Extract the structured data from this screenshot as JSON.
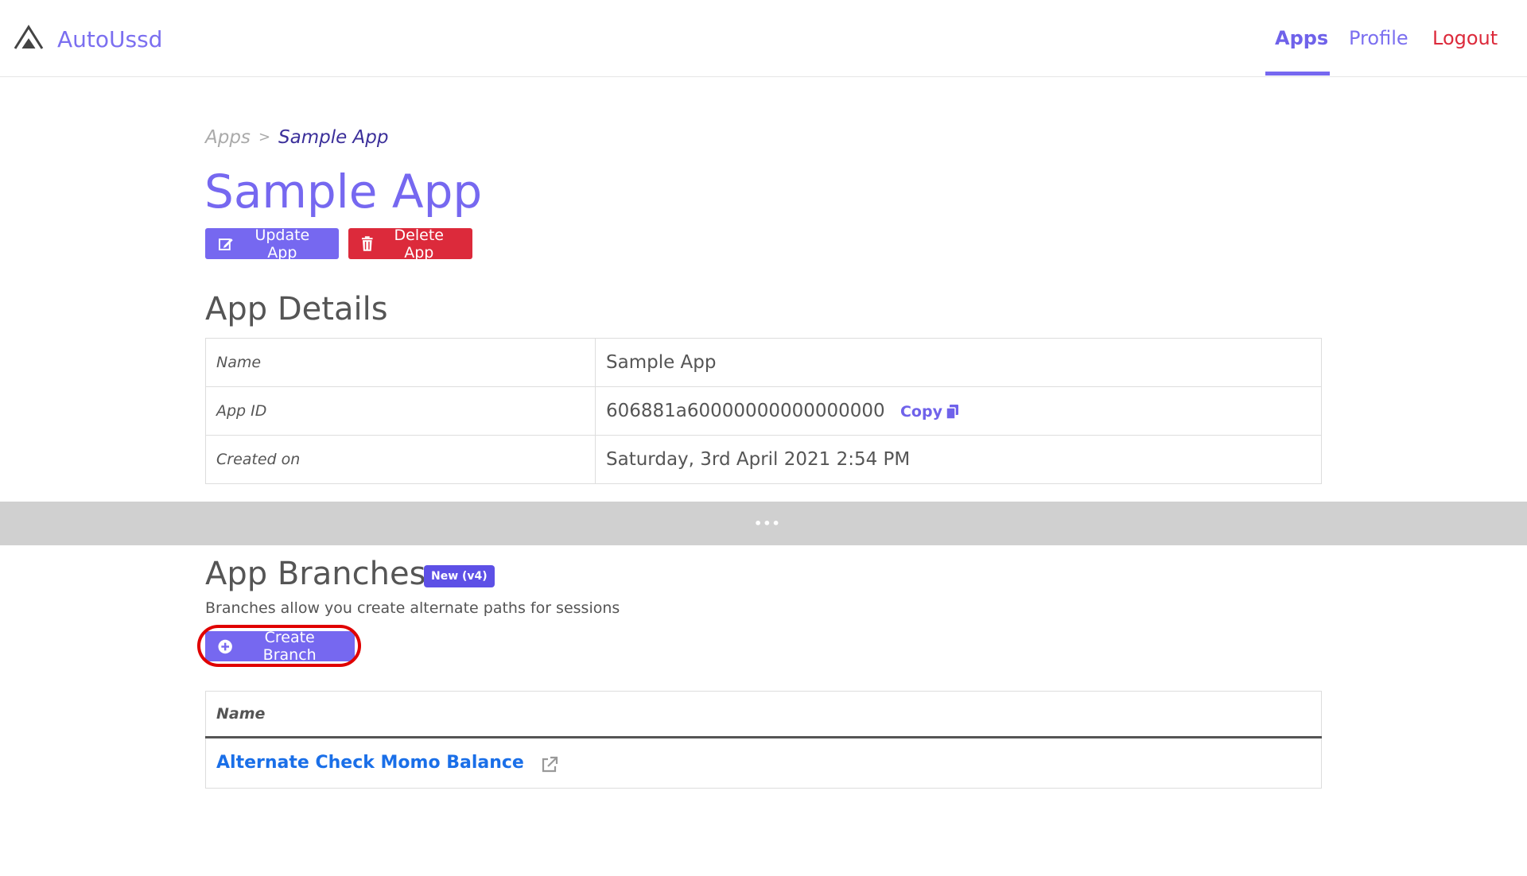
{
  "header": {
    "brand": "AutoUssd",
    "nav": {
      "apps": "Apps",
      "profile": "Profile",
      "logout": "Logout"
    }
  },
  "breadcrumb": {
    "root": "Apps",
    "separator": ">",
    "current": "Sample App"
  },
  "page_title": "Sample App",
  "actions": {
    "update": "Update App",
    "delete": "Delete App"
  },
  "details": {
    "heading": "App Details",
    "rows": [
      {
        "key": "Name",
        "value": "Sample App"
      },
      {
        "key": "App ID",
        "value": "606881a60000000000000000",
        "action": "Copy"
      },
      {
        "key": "Created on",
        "value": "Saturday, 3rd April 2021 2:54 PM"
      }
    ]
  },
  "divider": {
    "handle": "•••"
  },
  "branches": {
    "heading": "App Branches",
    "badge": "New (v4)",
    "description": "Branches allow you create alternate paths for sessions",
    "create_label": "Create Branch",
    "table": {
      "header_name": "Name",
      "rows": [
        {
          "name": "Alternate Check Momo Balance"
        }
      ]
    }
  },
  "colors": {
    "accent": "#7668f0",
    "danger": "#dc2a3b",
    "link": "#1a6fe8",
    "highlight": "#e00000"
  }
}
